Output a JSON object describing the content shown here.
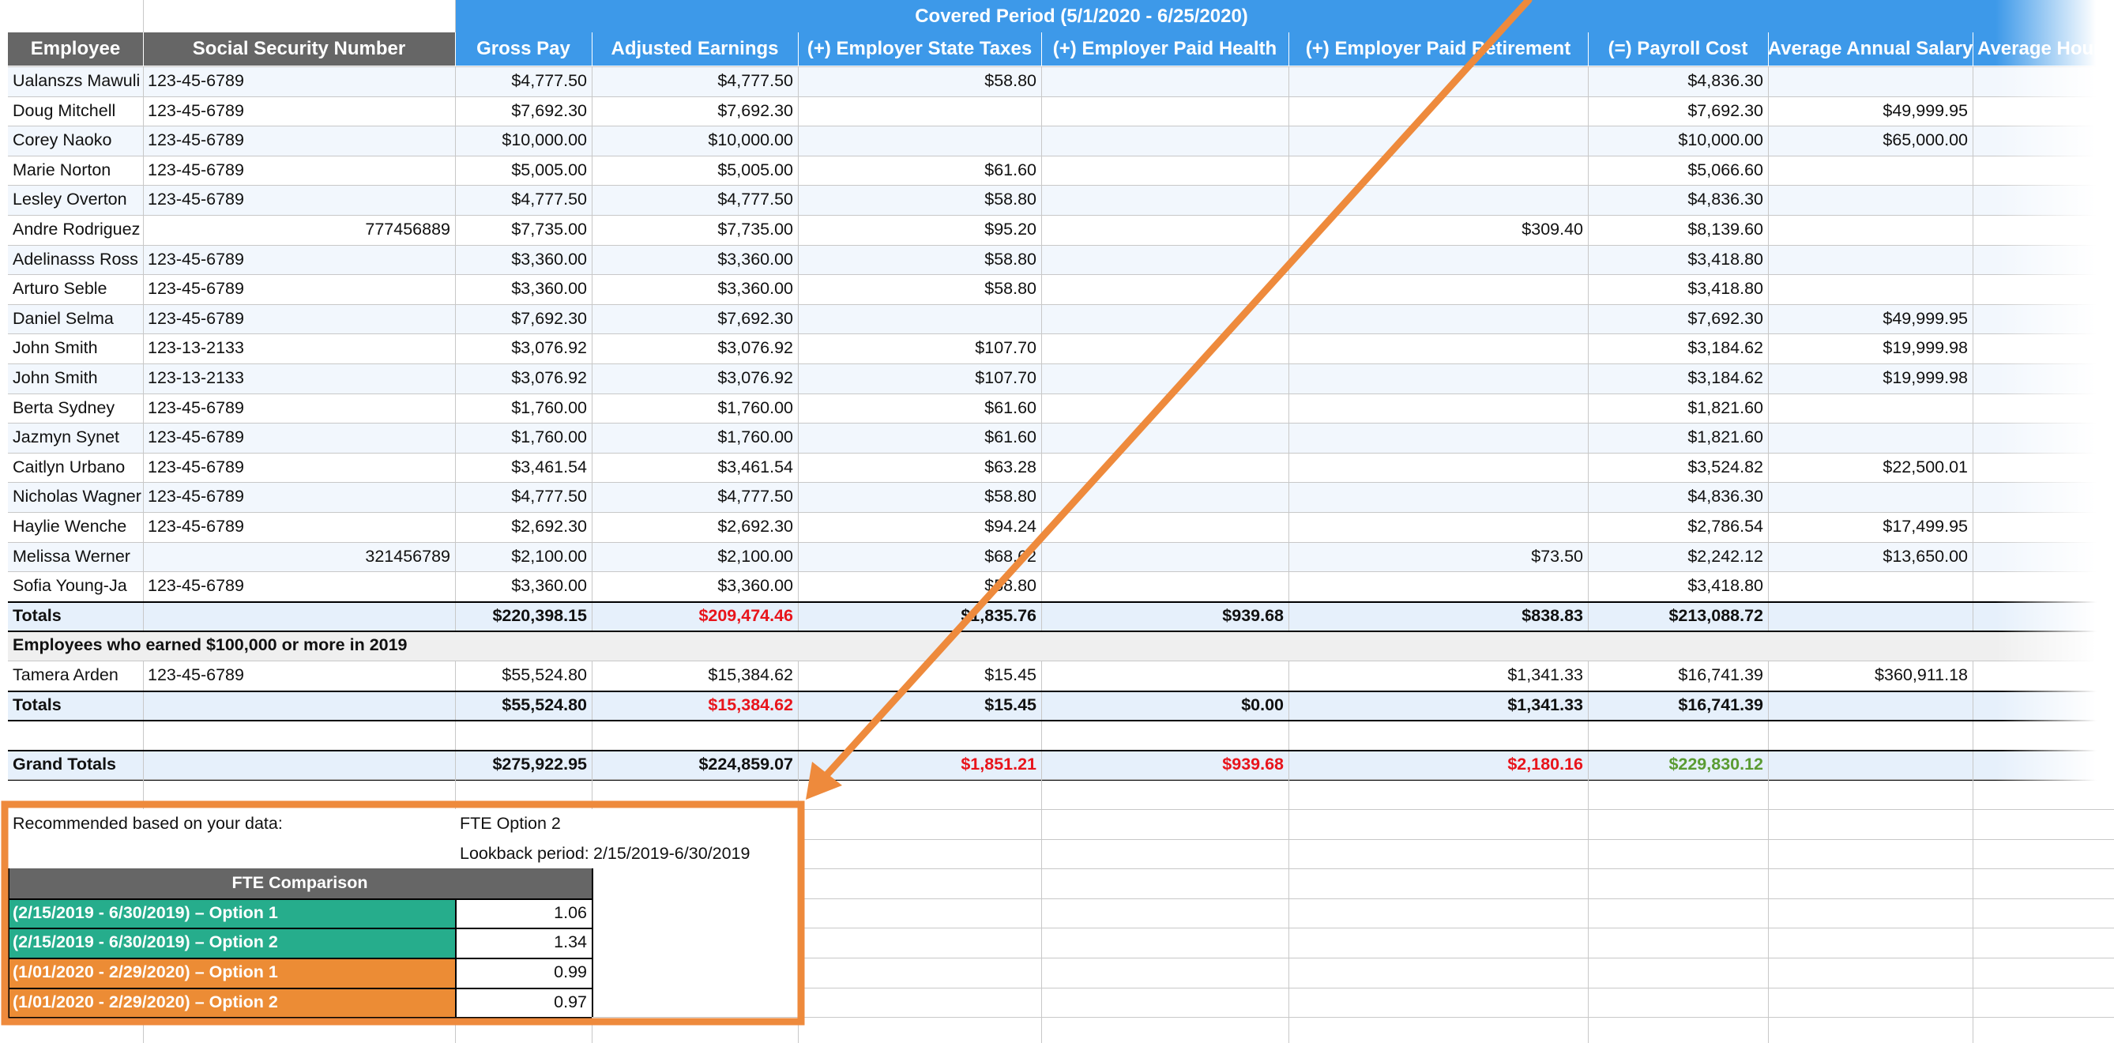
{
  "header": {
    "banner": "Covered Period (5/1/2020 - 6/25/2020)",
    "columns": [
      "Employee",
      "Social Security Number",
      "Gross Pay",
      "Adjusted Earnings",
      "(+) Employer State Taxes",
      "(+) Employer Paid Health",
      "(+) Employer Paid Retirement",
      "(=) Payroll Cost",
      "Average Annual Salary",
      "Average Hourly"
    ]
  },
  "rows": [
    [
      "Ualanszs Mawuli",
      "123-45-6789",
      "$4,777.50",
      "$4,777.50",
      "$58.80",
      "",
      "",
      "$4,836.30",
      "",
      ""
    ],
    [
      "Doug Mitchell",
      "123-45-6789",
      "$7,692.30",
      "$7,692.30",
      "",
      "",
      "",
      "$7,692.30",
      "$49,999.95",
      ""
    ],
    [
      "Corey Naoko",
      "123-45-6789",
      "$10,000.00",
      "$10,000.00",
      "",
      "",
      "",
      "$10,000.00",
      "$65,000.00",
      ""
    ],
    [
      "Marie Norton",
      "123-45-6789",
      "$5,005.00",
      "$5,005.00",
      "$61.60",
      "",
      "",
      "$5,066.60",
      "",
      ""
    ],
    [
      "Lesley Overton",
      "123-45-6789",
      "$4,777.50",
      "$4,777.50",
      "$58.80",
      "",
      "",
      "$4,836.30",
      "",
      ""
    ],
    [
      "Andre Rodriguez",
      "777456889",
      "$7,735.00",
      "$7,735.00",
      "$95.20",
      "",
      "$309.40",
      "$8,139.60",
      "",
      ""
    ],
    [
      "Adelinasss Ross",
      "123-45-6789",
      "$3,360.00",
      "$3,360.00",
      "$58.80",
      "",
      "",
      "$3,418.80",
      "",
      ""
    ],
    [
      "Arturo Seble",
      "123-45-6789",
      "$3,360.00",
      "$3,360.00",
      "$58.80",
      "",
      "",
      "$3,418.80",
      "",
      ""
    ],
    [
      "Daniel Selma",
      "123-45-6789",
      "$7,692.30",
      "$7,692.30",
      "",
      "",
      "",
      "$7,692.30",
      "$49,999.95",
      ""
    ],
    [
      "John Smith",
      "123-13-2133",
      "$3,076.92",
      "$3,076.92",
      "$107.70",
      "",
      "",
      "$3,184.62",
      "$19,999.98",
      ""
    ],
    [
      "John Smith",
      "123-13-2133",
      "$3,076.92",
      "$3,076.92",
      "$107.70",
      "",
      "",
      "$3,184.62",
      "$19,999.98",
      ""
    ],
    [
      "Berta Sydney",
      "123-45-6789",
      "$1,760.00",
      "$1,760.00",
      "$61.60",
      "",
      "",
      "$1,821.60",
      "",
      ""
    ],
    [
      "Jazmyn Synet",
      "123-45-6789",
      "$1,760.00",
      "$1,760.00",
      "$61.60",
      "",
      "",
      "$1,821.60",
      "",
      ""
    ],
    [
      "Caitlyn Urbano",
      "123-45-6789",
      "$3,461.54",
      "$3,461.54",
      "$63.28",
      "",
      "",
      "$3,524.82",
      "$22,500.01",
      ""
    ],
    [
      "Nicholas Wagner",
      "123-45-6789",
      "$4,777.50",
      "$4,777.50",
      "$58.80",
      "",
      "",
      "$4,836.30",
      "",
      ""
    ],
    [
      "Haylie Wenche",
      "123-45-6789",
      "$2,692.30",
      "$2,692.30",
      "$94.24",
      "",
      "",
      "$2,786.54",
      "$17,499.95",
      ""
    ],
    [
      "Melissa Werner",
      "321456789",
      "$2,100.00",
      "$2,100.00",
      "$68.62",
      "",
      "$73.50",
      "$2,242.12",
      "$13,650.00",
      ""
    ],
    [
      "Sofia Young-Ja",
      "123-45-6789",
      "$3,360.00",
      "$3,360.00",
      "$58.80",
      "",
      "",
      "$3,418.80",
      "",
      ""
    ]
  ],
  "totals": [
    "Totals",
    "",
    "$220,398.15",
    "$209,474.46",
    "$1,835.76",
    "$939.68",
    "$838.83",
    "$213,088.72",
    "",
    ""
  ],
  "section2_label": "Employees who earned $100,000 or more in 2019",
  "rows2": [
    [
      "Tamera Arden",
      "123-45-6789",
      "$55,524.80",
      "$15,384.62",
      "$15.45",
      "",
      "$1,341.33",
      "$16,741.39",
      "$360,911.18",
      ""
    ]
  ],
  "totals2": [
    "Totals",
    "",
    "$55,524.80",
    "$15,384.62",
    "$15.45",
    "$0.00",
    "$1,341.33",
    "$16,741.39",
    "",
    ""
  ],
  "grand_totals": [
    "Grand Totals",
    "",
    "$275,922.95",
    "$224,859.07",
    "$1,851.21",
    "$939.68",
    "$2,180.16",
    "$229,830.12",
    "",
    ""
  ],
  "recommendation": {
    "label": "Recommended based on your data:",
    "value": "FTE Option 2",
    "lookback_label": "Lookback period:",
    "lookback_value": "2/15/2019-6/30/2019"
  },
  "fte": {
    "title": "FTE Comparison",
    "rows": [
      {
        "label": "(2/15/2019 - 6/30/2019) – Option 1",
        "value": "1.06",
        "color": "#26ad8c"
      },
      {
        "label": "(2/15/2019 - 6/30/2019) – Option 2",
        "value": "1.34",
        "color": "#26ad8c"
      },
      {
        "label": "(1/01/2020 - 2/29/2020) – Option 1",
        "value": "0.99",
        "color": "#ec8c35"
      },
      {
        "label": "(1/01/2020 - 2/29/2020) – Option 2",
        "value": "0.97",
        "color": "#ec8c35"
      }
    ]
  },
  "annotation_color": "#ee8a3c"
}
